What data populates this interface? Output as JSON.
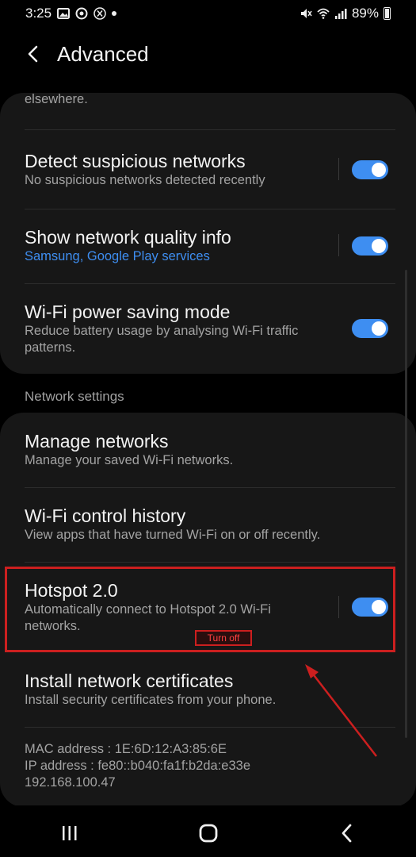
{
  "status_bar": {
    "time": "3:25",
    "battery_pct": "89%"
  },
  "header": {
    "title": "Advanced"
  },
  "card1": {
    "clipped_text": "elsewhere.",
    "rows": [
      {
        "title": "Detect suspicious networks",
        "subtitle": "No suspicious networks detected recently",
        "toggle_on": true
      },
      {
        "title": "Show network quality info",
        "subtitle": "Samsung, Google Play services",
        "toggle_on": true
      },
      {
        "title": "Wi-Fi power saving mode",
        "subtitle": "Reduce battery usage by analysing Wi-Fi traffic patterns.",
        "toggle_on": true
      }
    ]
  },
  "section": {
    "network_settings": "Network settings"
  },
  "card2": {
    "manage_networks": {
      "title": "Manage networks",
      "subtitle": "Manage your saved Wi-Fi networks."
    },
    "control_history": {
      "title": "Wi-Fi control history",
      "subtitle": "View apps that have turned Wi-Fi on or off recently."
    },
    "hotspot": {
      "title": "Hotspot 2.0",
      "subtitle": "Automatically connect to Hotspot 2.0 Wi-Fi networks.",
      "toggle_on": true
    },
    "certificates": {
      "title": "Install network certificates",
      "subtitle": "Install security certificates from your phone."
    },
    "mac": "MAC address : 1E:6D:12:A3:85:6E",
    "ip": "IP address : fe80::b040:fa1f:b2da:e33e",
    "ipv4": "192.168.100.47"
  },
  "annotation": {
    "note": "Turn off",
    "color": "#cc1f1f"
  },
  "colors": {
    "accent": "#3e8ef1",
    "card": "#171717",
    "background": "#000000"
  }
}
